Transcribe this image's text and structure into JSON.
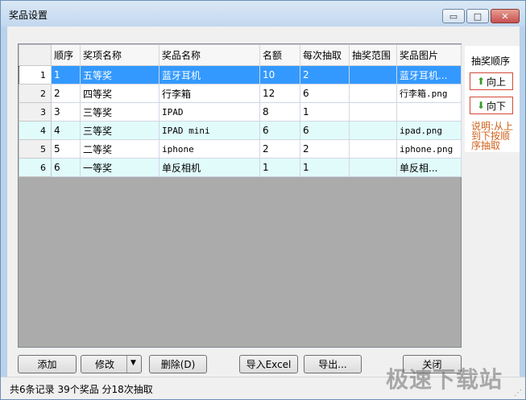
{
  "window": {
    "title": "奖品设置",
    "min_label": "▭",
    "max_label": "□",
    "close_label": "✕"
  },
  "grid": {
    "columns": [
      "顺序",
      "奖项名称",
      "奖品名称",
      "名额",
      "每次抽取",
      "抽奖范围",
      "奖品图片"
    ],
    "rows": [
      {
        "num": "1",
        "order": "1",
        "prize_level": "五等奖",
        "prize_name": "蓝牙耳机",
        "quota": "10",
        "per_draw": "2",
        "range": "",
        "image": "蓝牙耳机..."
      },
      {
        "num": "2",
        "order": "2",
        "prize_level": "四等奖",
        "prize_name": "行李箱",
        "quota": "12",
        "per_draw": "6",
        "range": "",
        "image": "行李箱.png"
      },
      {
        "num": "3",
        "order": "3",
        "prize_level": "三等奖",
        "prize_name": "IPAD",
        "quota": "8",
        "per_draw": "1",
        "range": "",
        "image": ""
      },
      {
        "num": "4",
        "order": "4",
        "prize_level": "三等奖",
        "prize_name": "IPAD mini",
        "quota": "6",
        "per_draw": "6",
        "range": "",
        "image": "ipad.png"
      },
      {
        "num": "5",
        "order": "5",
        "prize_level": "二等奖",
        "prize_name": "iphone",
        "quota": "2",
        "per_draw": "2",
        "range": "",
        "image": "iphone.png"
      },
      {
        "num": "6",
        "order": "6",
        "prize_level": "一等奖",
        "prize_name": "单反相机",
        "quota": "1",
        "per_draw": "1",
        "range": "",
        "image": "单反相..."
      }
    ]
  },
  "side": {
    "title": "抽奖顺序",
    "up_label": "向上",
    "down_label": "向下",
    "note": "说明:从上到下按顺序抽取"
  },
  "buttons": {
    "add": "添加",
    "edit": "修改",
    "delete": "删除(D)",
    "import_excel": "导入Excel",
    "export": "导出...",
    "close": "关闭"
  },
  "status": {
    "text": "共6条记录 39个奖品 分18次抽取"
  },
  "watermark": "极速下载站",
  "colors": {
    "selected_row": "#3399ff",
    "alt_row": "#e1fbfb",
    "note_color": "#d0601a",
    "arrow_color": "#3a9a2a"
  }
}
